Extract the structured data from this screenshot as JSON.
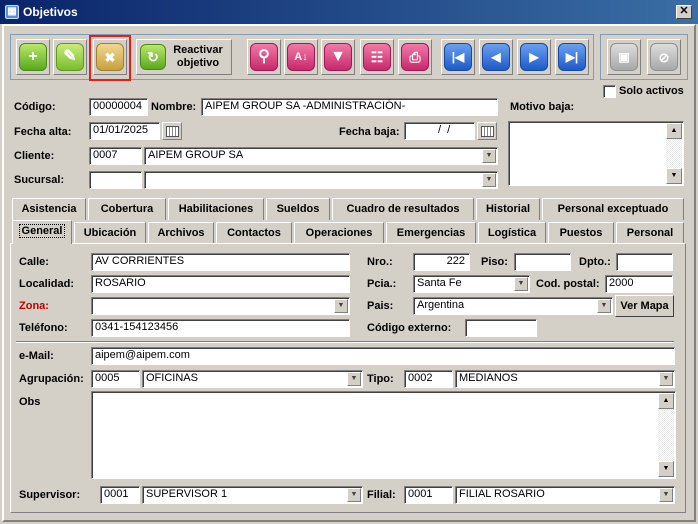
{
  "window": {
    "title": "Objetivos",
    "close_glyph": "✕"
  },
  "toolbar": {
    "reactivate_label_1": "Reactivar",
    "reactivate_label_2": "objetivo",
    "solo_activos": "Solo activos"
  },
  "header": {
    "codigo_label": "Código:",
    "codigo_value": "00000004",
    "nombre_label": "Nombre:",
    "nombre_value": "AIPEM GROUP SA -ADMINISTRACIÓN-",
    "motivo_baja_label": "Motivo baja:",
    "fecha_alta_label": "Fecha alta:",
    "fecha_alta_value": "01/01/2025",
    "fecha_baja_label": "Fecha baja:",
    "fecha_baja_value": "  /  /",
    "cliente_label": "Cliente:",
    "cliente_code": "0007",
    "cliente_name": "AIPEM GROUP SA",
    "sucursal_label": "Sucursal:",
    "sucursal_code": "",
    "sucursal_name": ""
  },
  "tabs_row1": [
    "Asistencia",
    "Cobertura",
    "Habilitaciones",
    "Sueldos",
    "Cuadro de resultados",
    "Historial",
    "Personal exceptuado"
  ],
  "tabs_row2": [
    "General",
    "Ubicación",
    "Archivos",
    "Contactos",
    "Operaciones",
    "Emergencias",
    "Logística",
    "Puestos",
    "Personal"
  ],
  "general": {
    "calle_label": "Calle:",
    "calle_value": "AV CORRIENTES",
    "nro_label": "Nro.:",
    "nro_value": "222",
    "piso_label": "Piso:",
    "piso_value": "",
    "dpto_label": "Dpto.:",
    "dpto_value": "",
    "localidad_label": "Localidad:",
    "localidad_value": "ROSARIO",
    "pcia_label": "Pcia.:",
    "pcia_value": "Santa Fe",
    "cp_label": "Cod. postal:",
    "cp_value": "2000",
    "zona_label": "Zona:",
    "zona_value": "",
    "pais_label": "Pais:",
    "pais_value": "Argentina",
    "ver_mapa": "Ver Mapa",
    "telefono_label": "Teléfono:",
    "telefono_value": "0341-154123456",
    "codigo_externo_label": "Código externo:",
    "codigo_externo_value": "",
    "email_label": "e-Mail:",
    "email_value": "aipem@aipem.com",
    "agrupacion_label": "Agrupación:",
    "agrupacion_code": "0005",
    "agrupacion_name": "OFICINAS",
    "tipo_label": "Tipo:",
    "tipo_code": "0002",
    "tipo_name": "MEDIANOS",
    "obs_label": "Obs",
    "supervisor_label": "Supervisor:",
    "supervisor_code": "0001",
    "supervisor_name": "SUPERVISOR 1",
    "filial_label": "Filial:",
    "filial_code": "0001",
    "filial_name": "FILIAL ROSARIO"
  },
  "colors": {
    "title_bar": "#0a246a",
    "highlight": "#e02020",
    "zona_label": "#c00000"
  }
}
